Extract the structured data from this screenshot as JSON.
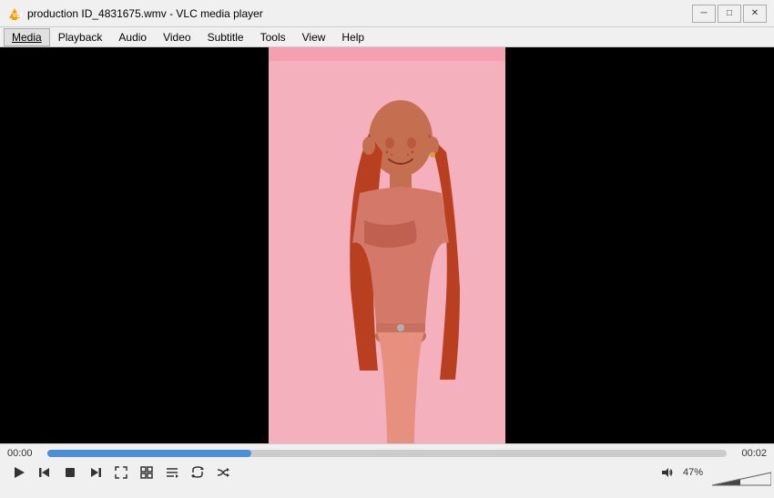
{
  "titlebar": {
    "title": "production ID_4831675.wmv - VLC media player",
    "minimize_label": "─",
    "maximize_label": "□",
    "close_label": "✕"
  },
  "menubar": {
    "items": [
      {
        "label": "Media",
        "active": true
      },
      {
        "label": "Playback",
        "active": false
      },
      {
        "label": "Audio",
        "active": false
      },
      {
        "label": "Video",
        "active": false
      },
      {
        "label": "Subtitle",
        "active": false
      },
      {
        "label": "Tools",
        "active": false
      },
      {
        "label": "View",
        "active": false
      },
      {
        "label": "Help",
        "active": false
      }
    ]
  },
  "player": {
    "time_left": "00:00",
    "time_right": "00:02",
    "seek_pct": 30,
    "volume_pct": "47%",
    "volume_level": 47
  },
  "controls": {
    "play": "▶",
    "rewind": "⏮",
    "stop": "⏹",
    "fast_forward": "⏭",
    "fullscreen": "⛶",
    "extended": "⊞",
    "playlist": "☰",
    "loop": "↻",
    "shuffle": "⇄"
  }
}
